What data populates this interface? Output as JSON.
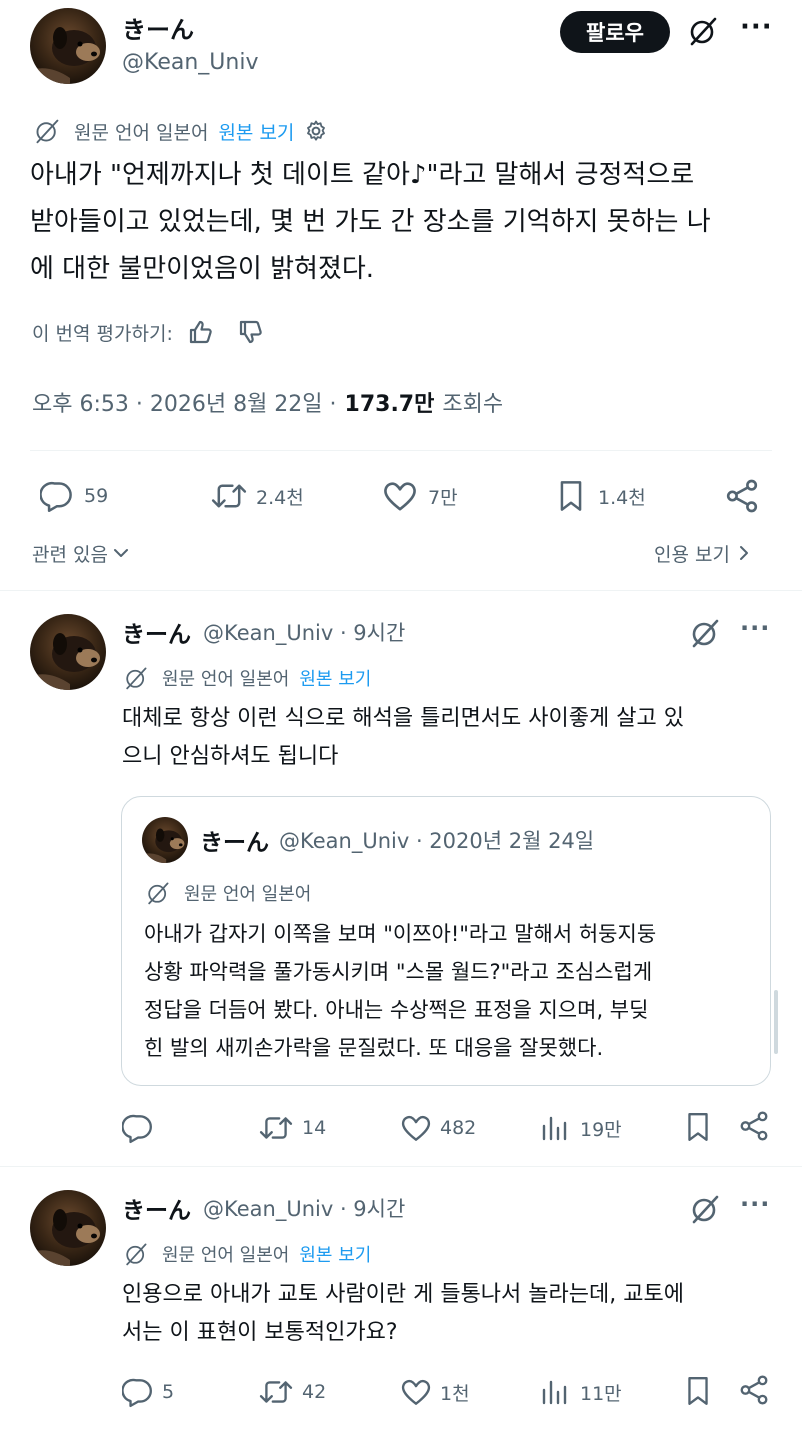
{
  "main_tweet": {
    "author_name": "きーん",
    "handle": "@Kean_Univ",
    "follow_label": "팔로우",
    "translation_meta": {
      "label": "원문 언어 일본어",
      "view_original": "원본 보기"
    },
    "body_lines": [
      "아내가 \"언제까지나 첫 데이트 같아♪\"라고 말해서 긍정적으로",
      "받아들이고 있었는데, 몇 번 가도 간 장소를 기억하지 못하는 나",
      "에 대한 불만이었음이 밝혀졌다."
    ],
    "rate_translation": "이 번역 평가하기:",
    "time": "오후 6:53 · 2026년 8월 22일 ·",
    "views_count": "173.7만",
    "views_label": "조회수",
    "actions": {
      "replies": "59",
      "retweets": "2.4천",
      "likes": "7만",
      "bookmarks": "1.4천"
    },
    "related_label": "관련 있음",
    "view_quotes_label": "인용 보기"
  },
  "reply1": {
    "author_name": "きーん",
    "handle_time": "@Kean_Univ · 9시간",
    "translation_meta": {
      "label": "원문 언어 일본어",
      "view_original": "원본 보기"
    },
    "body_lines": [
      "대체로 항상 이런 식으로 해석을 틀리면서도 사이좋게 살고 있",
      "으니 안심하셔도 됩니다"
    ],
    "quote": {
      "author_name": "きーん",
      "handle_date": "@Kean_Univ · 2020년 2월 24일",
      "translation_label": "원문 언어 일본어",
      "body_lines": [
        "아내가 갑자기 이쪽을 보며 \"이쯔아!\"라고 말해서 허둥지둥",
        "상황 파악력을 풀가동시키며 \"스몰 월드?\"라고 조심스럽게",
        "정답을 더듬어 봤다. 아내는 수상쩍은 표정을 지으며, 부딪",
        "힌 발의 새끼손가락을 문질렀다. 또 대응을 잘못했다."
      ]
    },
    "actions": {
      "replies": "",
      "retweets": "14",
      "likes": "482",
      "views": "19만"
    }
  },
  "reply2": {
    "author_name": "きーん",
    "handle_time": "@Kean_Univ · 9시간",
    "translation_meta": {
      "label": "원문 언어 일본어",
      "view_original": "원본 보기"
    },
    "body_lines": [
      "인용으로 아내가 교토 사람이란 게 들통나서 놀라는데, 교토에",
      "서는 이 표현이 보통적인가요?"
    ],
    "actions": {
      "replies": "5",
      "retweets": "42",
      "likes": "1천",
      "views": "11만"
    }
  },
  "icons": {
    "grok": "grok-slash-icon",
    "more": "more-dots-icon",
    "translate": "translate-icon",
    "gear": "gear-icon",
    "thumbs_up": "thumbs-up-icon",
    "thumbs_down": "thumbs-down-icon",
    "reply": "reply-bubble-icon",
    "retweet": "retweet-icon",
    "like": "heart-icon",
    "bookmark": "bookmark-icon",
    "share": "share-icon",
    "views": "views-bars-icon"
  },
  "colors": {
    "accent": "#1d9bf0",
    "text": "#0f1419",
    "muted": "#536471",
    "border": "#cfd9de"
  }
}
